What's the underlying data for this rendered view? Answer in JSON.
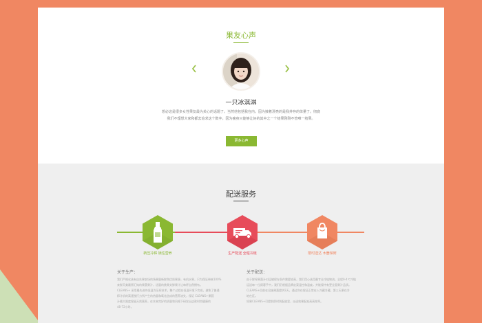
{
  "testimonial": {
    "title": "果友心声",
    "name": "一只冰淇淋",
    "quote_line1": "想必这是很多女性果友最为关心的话题了，当然他包括我在内，因为接着漂亮的是我并存的体量了。彻底",
    "quote_line2": "我们不理想大家和都去追求这个数字，因为瘦身只能够让好的其中之一个结果刚刚不管唯一结果。",
    "more_button": "更多心声"
  },
  "delivery": {
    "title": "配送服务",
    "services": [
      {
        "label": "新压冷榨 锁住营养",
        "icon": "bottle-icon",
        "color": "#8ab832"
      },
      {
        "label": "生产配送 全程冷链",
        "icon": "delivery-truck-icon",
        "color": "#e74c5a"
      },
      {
        "label": "限时送达 木器保鲜",
        "icon": "shopping-bag-icon",
        "color": "#f08762"
      }
    ],
    "production": {
      "title": "关于生产：",
      "lines": [
        "我们严格化选有自先果农场的场果量新鲜然优质果源，有机水果，只为保证带来100%",
        "来鲜天美最原汇纯的果蔬果汁，适量的挑果关鲜果汁让每杯自然拥有。",
        "CLEANS+ 采用最先进的低温冷压榨技术，整个过程在低温环境下完成，避免了普通",
        "榨汁机的高速搅打力所产生的热量和氧化造成的营养流失，保证 CLEANS+果蔬",
        "汁最大限度保留天然营养，在本来完好的质量和风格下研发出这款时尚健康的",
        "48-72小时。"
      ]
    },
    "shipping": {
      "title": "关于配送：",
      "lines": [
        "由于鲜榨果蔬汁对运输保存条件需要较高，我们用心选用最专业冷链物流，全程0-4℃冷链",
        "运送每一位顾客手中，我们仍根据品牌定案温控和温度，并能保持有更全面果汁品质。",
        "CLEANS+目前在设施果蔬提供2天，通过你在保证正常在入冷藏冷藏，第三天果在冷",
        "地在区。",
        "如果CLEANS+可提前即时到配放里，派送效果配准高高效率。"
      ]
    }
  }
}
